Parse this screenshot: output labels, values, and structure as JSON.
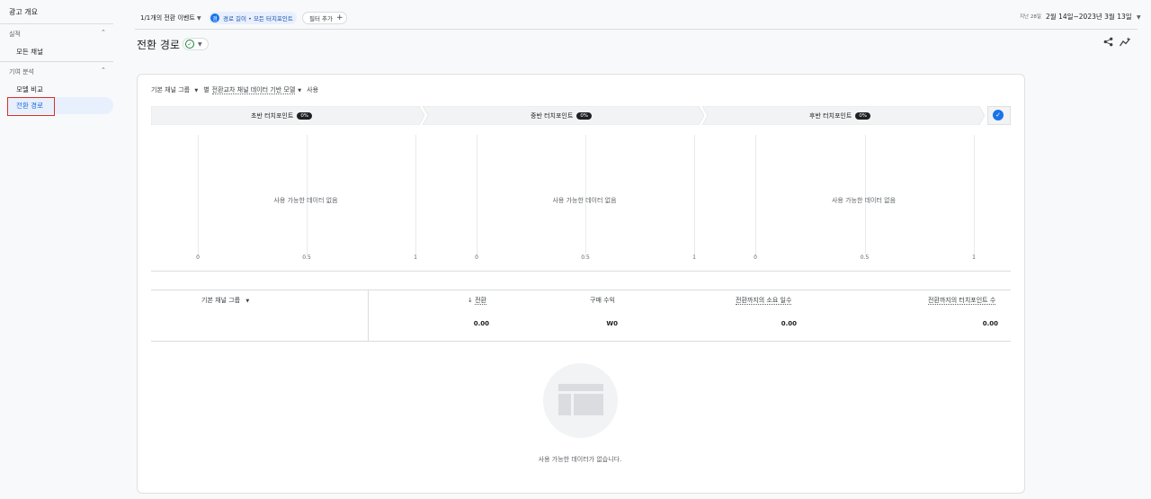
{
  "sidebar": {
    "top_item": "광고 개요",
    "sections": [
      {
        "title": "실적",
        "items": [
          "모든 채널"
        ]
      },
      {
        "title": "기여 분석",
        "items": [
          "모델 비교",
          "전환 경로"
        ]
      }
    ],
    "active_item": "전환 경로"
  },
  "topbar": {
    "event_selector": "1/1개의 전환 이벤트",
    "filter_chip_icon": "경",
    "filter_chip": "경로 길이 • 모든 터치포인트",
    "add_filter": "필터 추가",
    "date_prefix": "지난 28일",
    "date_range": "2월 14일~2023년 3월 13일"
  },
  "page": {
    "title": "전환 경로"
  },
  "config": {
    "dimension": "기본 채널 그룹",
    "separator": "별",
    "model": "전환교차 채널 데이터 기반 모델",
    "suffix": "사용"
  },
  "stages": [
    {
      "label": "초반 터치포인트",
      "pct": "0%"
    },
    {
      "label": "중반 터치포인트",
      "pct": "0%"
    },
    {
      "label": "후반 터치포인트",
      "pct": "0%"
    }
  ],
  "chart_data": [
    {
      "type": "bar",
      "title": "초반 터치포인트",
      "x_ticks": [
        "0",
        "0.5",
        "1"
      ],
      "xlim": [
        0,
        1
      ],
      "values": [],
      "empty_text": "사용 가능한 데이터 없음"
    },
    {
      "type": "bar",
      "title": "중반 터치포인트",
      "x_ticks": [
        "0",
        "0.5",
        "1"
      ],
      "xlim": [
        0,
        1
      ],
      "values": [],
      "empty_text": "사용 가능한 데이터 없음"
    },
    {
      "type": "bar",
      "title": "후반 터치포인트",
      "x_ticks": [
        "0",
        "0.5",
        "1"
      ],
      "xlim": [
        0,
        1
      ],
      "values": [],
      "empty_text": "사용 가능한 데이터 없음"
    }
  ],
  "table": {
    "dimension_header": "기본 채널 그룹",
    "columns": [
      "전환",
      "구매 수익",
      "전환까지의 소요 일수",
      "전환까지의 터치포인트 수"
    ],
    "totals": [
      "0.00",
      "W0",
      "0.00",
      "0.00"
    ]
  },
  "empty_state": "사용 가능한 데이터가 없습니다.",
  "colors": {
    "accent": "#1a73e8",
    "highlight": "#d93025",
    "success": "#188038"
  }
}
